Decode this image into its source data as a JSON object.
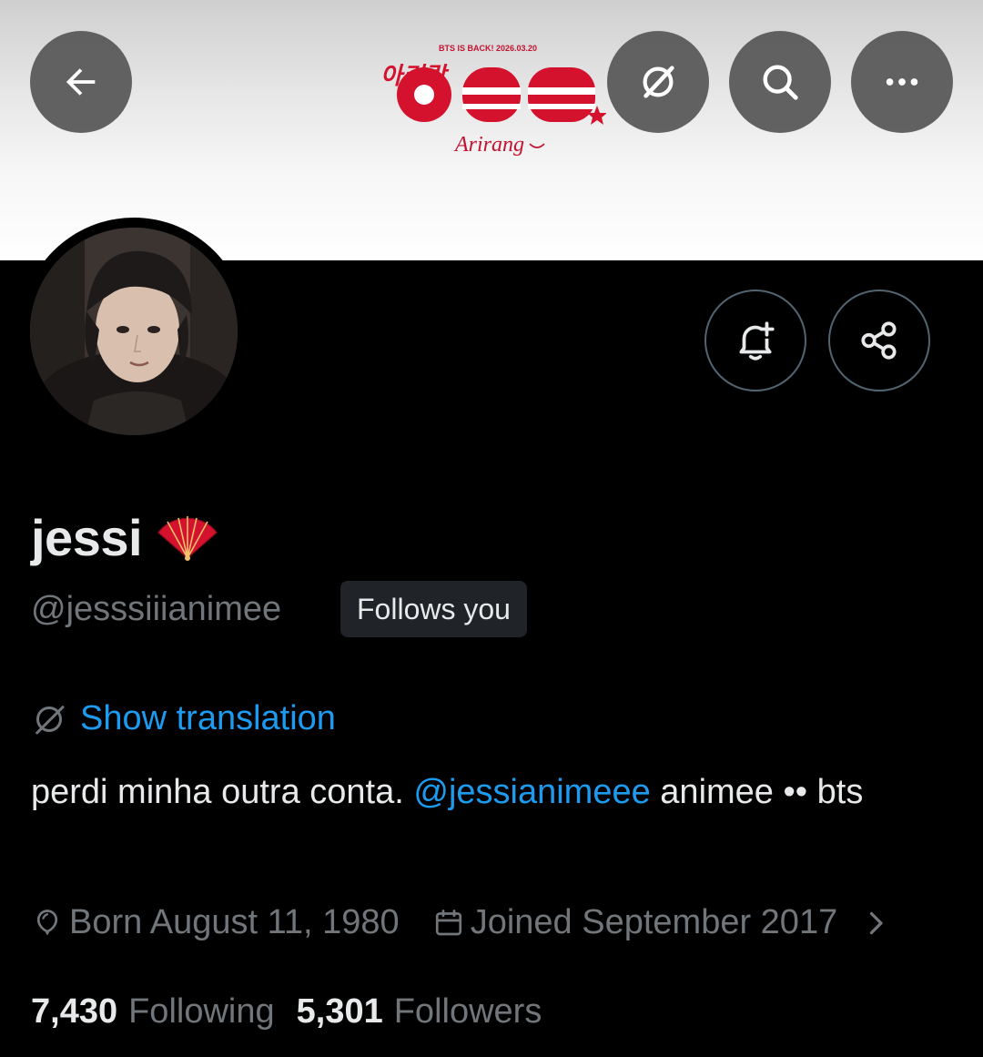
{
  "banner": {
    "caption": "BTS IS BACK! 2026.03.20",
    "title": "Arirang",
    "korean": "아리랑"
  },
  "profile": {
    "display_name": "jessi",
    "handle": "@jesssiiianimee",
    "follows_you": "Follows you",
    "show_translation": "Show translation",
    "bio_text_1": "perdi minha outra conta.",
    "bio_mention": "@jessianimeee",
    "bio_text_2": "animee •• bts",
    "born": "Born August 11, 1980",
    "joined": "Joined September 2017",
    "following_count": "7,430",
    "following_label": "Following",
    "followers_count": "5,301",
    "followers_label": "Followers"
  },
  "icons": {
    "back": "arrow-left-icon",
    "grok": "grok-icon",
    "search": "search-icon",
    "more": "more-icon",
    "notify": "bell-plus-icon",
    "share": "share-icon",
    "emoji": "folding-fan-icon",
    "translate": "translate-icon",
    "birthday": "balloon-icon",
    "calendar": "calendar-icon"
  },
  "colors": {
    "accent": "#1d9bf0",
    "banner_red": "#d4122e",
    "secondary_text": "#71767b"
  }
}
